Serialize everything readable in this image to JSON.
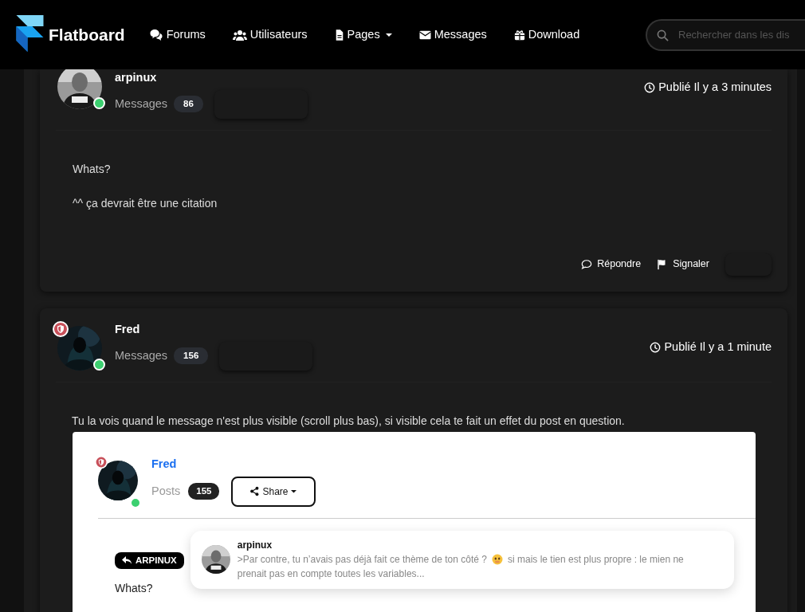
{
  "brand": "Flatboard",
  "nav": [
    {
      "label": "Forums",
      "kind": "comments",
      "dropdown": false
    },
    {
      "label": "Utilisateurs",
      "kind": "users",
      "dropdown": false
    },
    {
      "label": "Pages",
      "kind": "file",
      "dropdown": true
    },
    {
      "label": "Messages",
      "kind": "envelope",
      "dropdown": false
    },
    {
      "label": "Download",
      "kind": "gift",
      "dropdown": false
    }
  ],
  "search": {
    "placeholder": "Rechercher dans les dis"
  },
  "posts": [
    {
      "author": "arpinux",
      "moderator": false,
      "online": true,
      "stats_label": "Messages",
      "count": "86",
      "time": "Publié Il y a 3 minutes",
      "paragraphs": [
        "Whats?",
        "^^ ça devrait être une citation"
      ],
      "actions": [
        {
          "label": "Répondre",
          "kind": "reply"
        },
        {
          "label": "Signaler",
          "kind": "report"
        }
      ]
    },
    {
      "author": "Fred",
      "moderator": true,
      "online": true,
      "stats_label": "Messages",
      "count": "156",
      "time": "Publié Il y a 1 minute",
      "paragraphs": [
        "Tu la vois quand le message n'est plus visible (scroll plus bas), si visible cela te fait un effet du post en question."
      ],
      "screenshot": {
        "author": "Fred",
        "moderator": true,
        "online": true,
        "stats_label": "Posts",
        "count": "155",
        "share": "Share",
        "reply_tag": "ARPINUX",
        "text": "Whats?",
        "tooltip": {
          "author": "arpinux",
          "text_before": ">Par contre, tu n’avais pas déjà fait ce thème de ton côté ?",
          "text_middle": "si mais le tien est plus propre : le mien ne",
          "text_end": "prenait pas en compte toutes les variables..."
        }
      }
    }
  ]
}
